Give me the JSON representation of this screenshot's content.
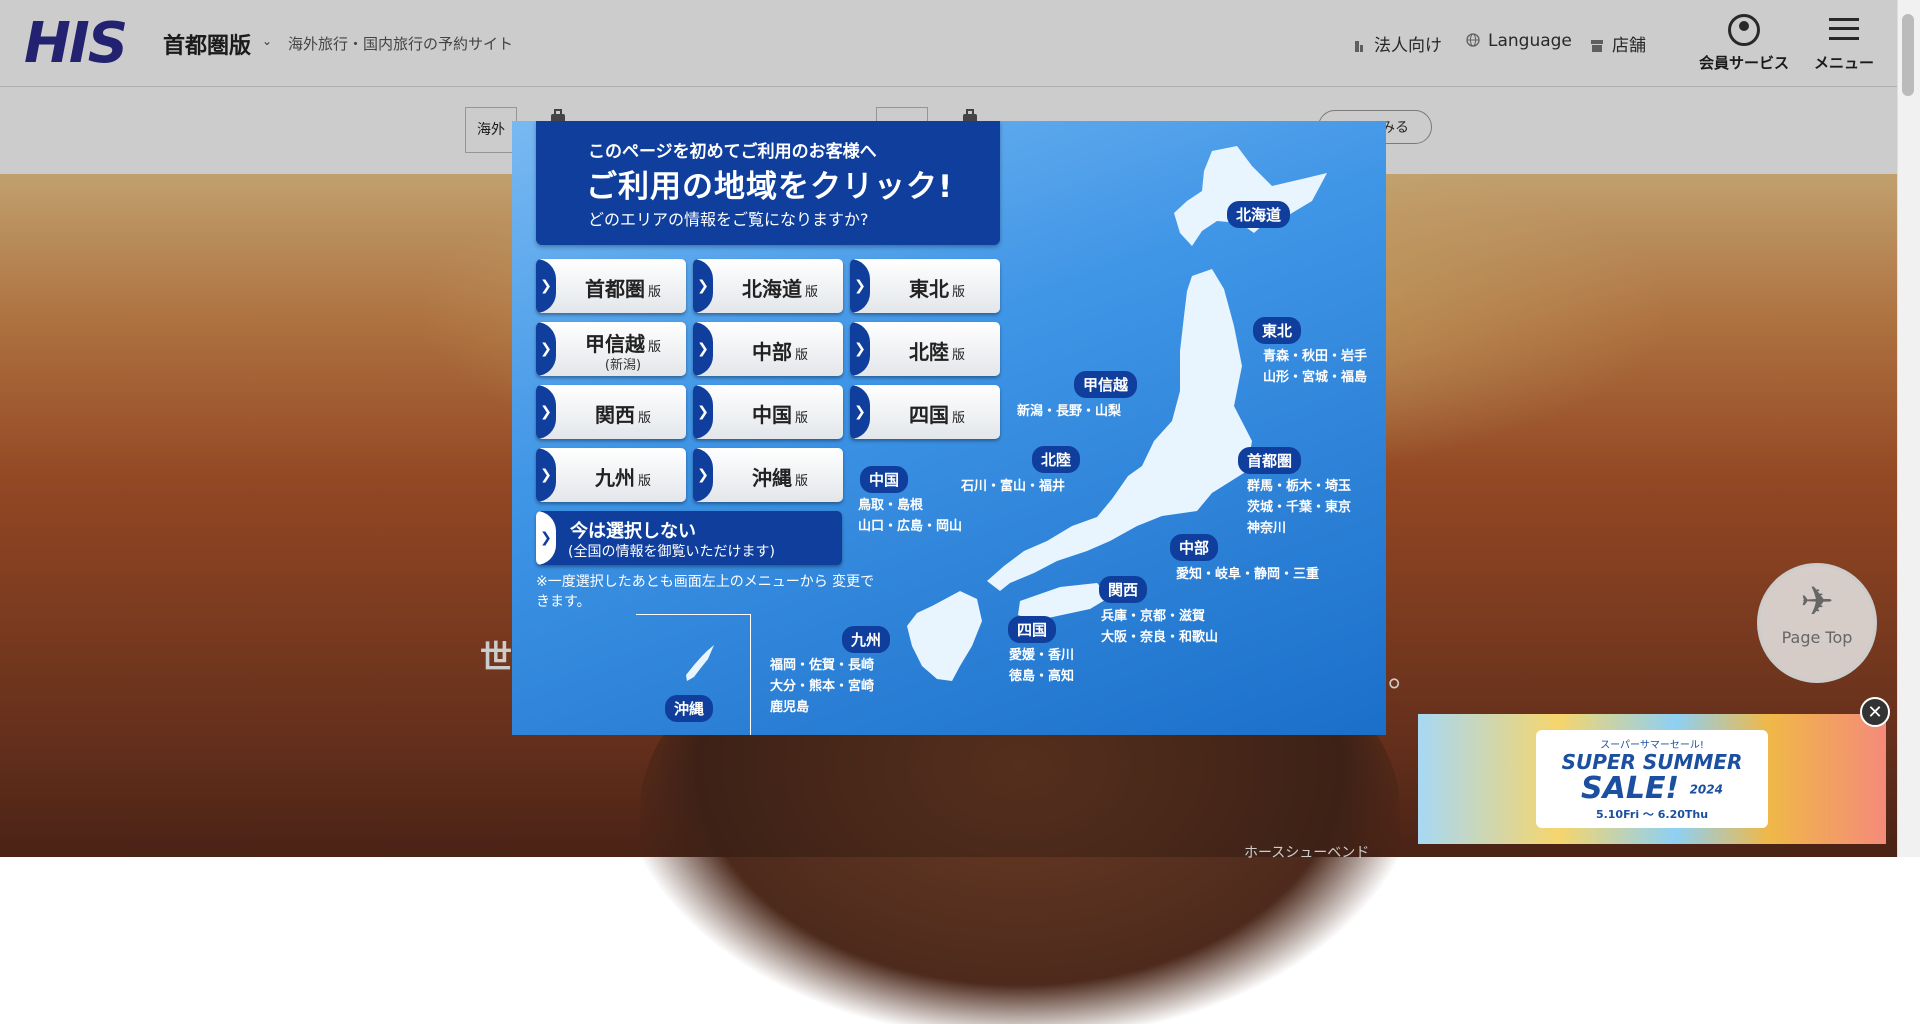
{
  "header": {
    "logo": "HIS",
    "region": "首都圏版",
    "tagline": "海外旅行・国内旅行の予約サイト",
    "links": [
      "法人向け",
      "Language",
      "店舗"
    ],
    "member_label": "会員サービス",
    "menu_label": "メニュー"
  },
  "search": {
    "tab_label": "海外",
    "button_label": "みる"
  },
  "hero": {
    "text": "世",
    "dot": "。",
    "caption": "ホースシューベンド"
  },
  "modal": {
    "line1": "このページを初めてご利用のお客様へ",
    "line2": "ご利用の地域をクリック!",
    "line3": "どのエリアの情報をご覧になりますか?",
    "version_suffix": "版",
    "regions": [
      {
        "name": "首都圏"
      },
      {
        "name": "北海道"
      },
      {
        "name": "東北"
      },
      {
        "name": "甲信越",
        "sub": "(新潟)"
      },
      {
        "name": "中部"
      },
      {
        "name": "北陸"
      },
      {
        "name": "関西"
      },
      {
        "name": "中国"
      },
      {
        "name": "四国"
      },
      {
        "name": "九州"
      },
      {
        "name": "沖縄"
      }
    ],
    "skip_title": "今は選択しない",
    "skip_sub": "(全国の情報を御覧いただけます)",
    "note": "※一度選択したあとも画面左上のメニューから 変更できます。",
    "map": {
      "hokkaido": "北海道",
      "tohoku": "東北",
      "tohoku_prefs_1": "青森・秋田・岩手",
      "tohoku_prefs_2": "山形・宮城・福島",
      "koshinetsu": "甲信越",
      "koshinetsu_prefs": "新潟・長野・山梨",
      "hokuriku": "北陸",
      "hokuriku_prefs": "石川・富山・福井",
      "shutoken": "首都圏",
      "shutoken_prefs_1": "群馬・栃木・埼玉",
      "shutoken_prefs_2": "茨城・千葉・東京",
      "shutoken_prefs_3": "神奈川",
      "chubu": "中部",
      "chubu_prefs": "愛知・岐阜・静岡・三重",
      "chugoku": "中国",
      "chugoku_prefs_1": "鳥取・島根",
      "chugoku_prefs_2": "山口・広島・岡山",
      "kansai": "関西",
      "kansai_prefs_1": "兵庫・京都・滋賀",
      "kansai_prefs_2": "大阪・奈良・和歌山",
      "shikoku": "四国",
      "shikoku_prefs_1": "愛媛・香川",
      "shikoku_prefs_2": "徳島・高知",
      "kyushu": "九州",
      "kyushu_prefs_1": "福岡・佐賀・長崎",
      "kyushu_prefs_2": "大分・熊本・宮崎",
      "kyushu_prefs_3": "鹿児島",
      "okinawa": "沖縄"
    }
  },
  "pagetop": {
    "label": "Page Top"
  },
  "banner": {
    "line1": "スーパーサマーセール!",
    "line2": "SUPER SUMMER",
    "line3": "SALE!",
    "badge": "2024",
    "dates": "5.10Fri ～ 6.20Thu",
    "close": "✕"
  }
}
